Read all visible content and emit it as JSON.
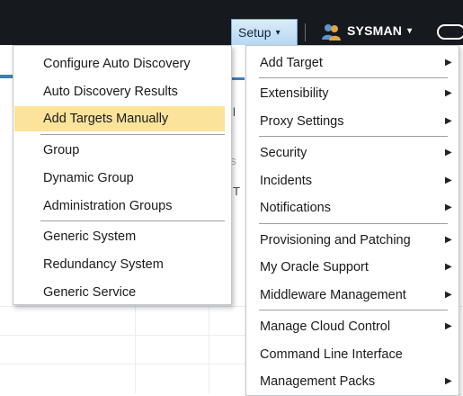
{
  "topbar": {
    "setup_label": "Setup",
    "setup_caret": "▾",
    "user_name": "SYSMAN",
    "user_caret": "▾",
    "user_icon": "user-group-icon"
  },
  "background": {
    "fragments": [
      "l",
      "T",
      "S"
    ]
  },
  "submenu": {
    "items": [
      {
        "label": "Configure Auto Discovery"
      },
      {
        "label": "Auto Discovery Results"
      },
      {
        "label": "Add Targets Manually",
        "active": true
      },
      {
        "label": "Group"
      },
      {
        "label": "Dynamic Group"
      },
      {
        "label": "Administration Groups"
      },
      {
        "label": "Generic System"
      },
      {
        "label": "Redundancy System"
      },
      {
        "label": "Generic Service"
      }
    ]
  },
  "mainmenu": {
    "arrow": "▶",
    "items": [
      {
        "label": "Add Target",
        "has_submenu": true
      },
      {
        "label": "Extensibility",
        "has_submenu": true
      },
      {
        "label": "Proxy Settings",
        "has_submenu": true
      },
      {
        "label": "Security",
        "has_submenu": true
      },
      {
        "label": "Incidents",
        "has_submenu": true
      },
      {
        "label": "Notifications",
        "has_submenu": true
      },
      {
        "label": "Provisioning and Patching",
        "has_submenu": true
      },
      {
        "label": "My Oracle Support",
        "has_submenu": true
      },
      {
        "label": "Middleware Management",
        "has_submenu": true
      },
      {
        "label": "Manage Cloud Control",
        "has_submenu": true
      },
      {
        "label": "Command Line Interface",
        "has_submenu": false
      },
      {
        "label": "Management Packs",
        "has_submenu": true
      }
    ]
  },
  "colors": {
    "topbar": "#16191d",
    "highlight": "#fbe39a",
    "setup_button": "#c7e1f7"
  }
}
